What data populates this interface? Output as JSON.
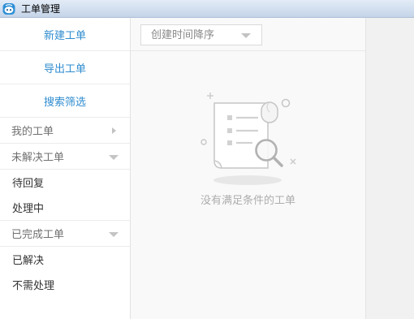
{
  "window": {
    "title": "工单管理",
    "icon": "app-logo-icon"
  },
  "sidebar": {
    "actions": [
      {
        "label": "新建工单"
      },
      {
        "label": "导出工单"
      },
      {
        "label": "搜索筛选"
      }
    ],
    "groups": [
      {
        "label": "我的工单",
        "expanded": false,
        "toggle_icon": "caret-right-icon",
        "items": []
      },
      {
        "label": "未解决工单",
        "expanded": true,
        "toggle_icon": "caret-down-icon",
        "items": [
          {
            "label": "待回复"
          },
          {
            "label": "处理中"
          }
        ]
      },
      {
        "label": "已完成工单",
        "expanded": true,
        "toggle_icon": "caret-down-icon",
        "items": [
          {
            "label": "已解决"
          },
          {
            "label": "不需处理"
          }
        ]
      }
    ]
  },
  "ticket_list": {
    "sort": {
      "selected": "创建时间降序",
      "icon": "chevron-down-icon"
    },
    "empty_state": {
      "message": "没有满足条件的工单",
      "illustration": "empty-document-search-icon"
    }
  },
  "colors": {
    "accent": "#2f8ccf",
    "panel_bg": "#f9f9f9",
    "detail_bg": "#f1f1f1",
    "muted_text": "#7a7a7a"
  }
}
